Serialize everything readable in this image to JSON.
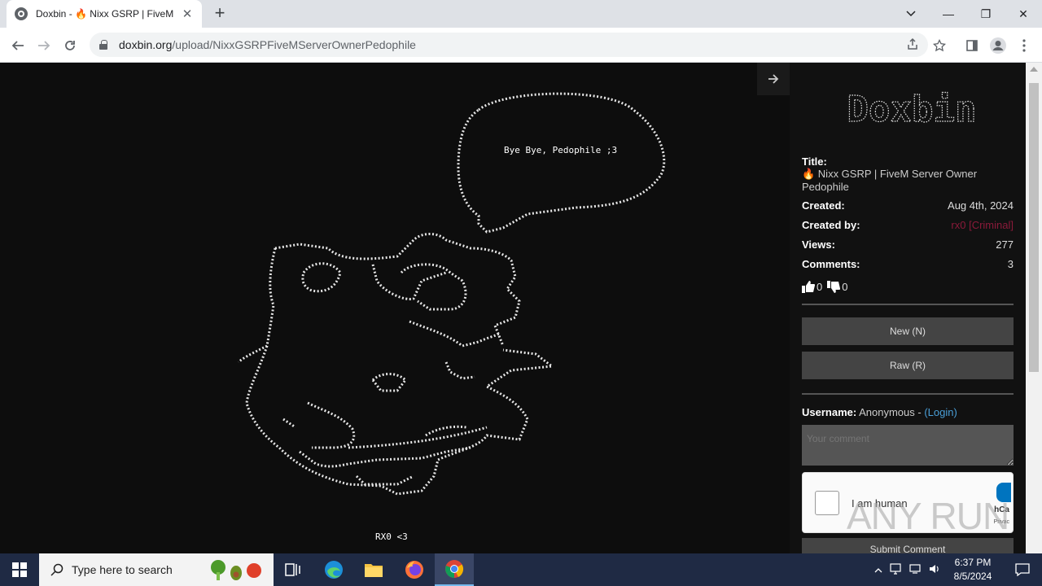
{
  "browser": {
    "tab_title": "Doxbin - 🔥 Nixx GSRP | FiveM S",
    "url_domain": "doxbin.org",
    "url_path": "/upload/NixxGSRPFiveMServerOwnerPedophile",
    "new_tab": "+",
    "close_tab": "✕",
    "minimize": "—",
    "restore": "❐",
    "close": "✕"
  },
  "ascii_art": {
    "speech": "Bye Bye, Pedophile ;3",
    "signature": "RX0 <3"
  },
  "sidebar": {
    "logo_text": "Doxbin",
    "title_label": "Title:",
    "title_value": "🔥 Nixx GSRP | FiveM Server Owner Pedophile",
    "created_label": "Created:",
    "created_value": "Aug 4th, 2024",
    "created_by_label": "Created by:",
    "created_by_value": "rx0 [Criminal]",
    "views_label": "Views:",
    "views_value": "277",
    "comments_label": "Comments:",
    "comments_value": "3",
    "likes": "0",
    "dislikes": "0",
    "new_button": "New (N)",
    "raw_button": "Raw (R)",
    "username_label": "Username:",
    "username_value": "Anonymous -",
    "login_link": "(Login)",
    "comment_placeholder": "Your comment",
    "captcha_label": "I am human",
    "captcha_brand": "hCa",
    "captcha_privacy": "Privac",
    "submit_button": "Submit Comment"
  },
  "watermark": "ANY RUN",
  "taskbar": {
    "search_placeholder": "Type here to search",
    "time": "6:37 PM",
    "date": "8/5/2024"
  },
  "colors": {
    "page_bg": "#0d0d0d",
    "sidebar_bg": "#111111",
    "creator_color": "#8b1a3a",
    "link_color": "#4a9fd8",
    "taskbar_bg": "#1f2a44"
  }
}
